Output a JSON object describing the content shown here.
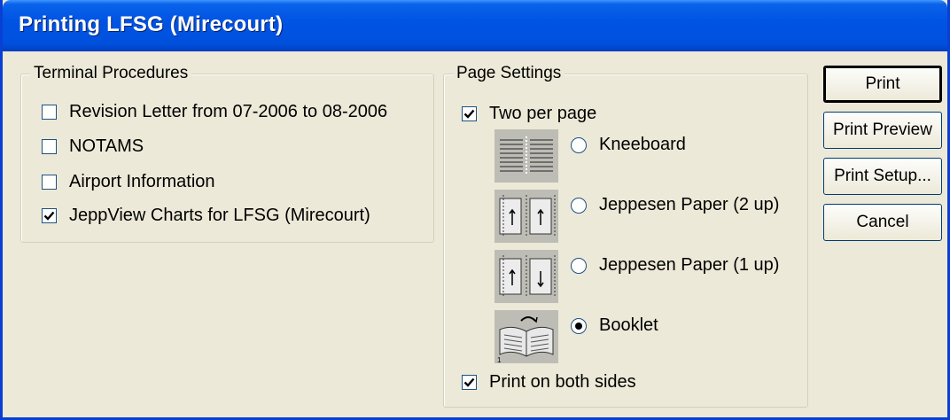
{
  "window": {
    "title": "Printing LFSG (Mirecourt)"
  },
  "terminal_procedures": {
    "legend": "Terminal Procedures",
    "items": [
      {
        "label": "Revision Letter from 07-2006 to 08-2006",
        "checked": false
      },
      {
        "label": "NOTAMS",
        "checked": false
      },
      {
        "label": "Airport Information",
        "checked": false
      },
      {
        "label": "JeppView Charts for LFSG (Mirecourt)",
        "checked": true
      }
    ]
  },
  "page_settings": {
    "legend": "Page Settings",
    "two_per_page": {
      "label": "Two per page",
      "checked": true
    },
    "layouts": [
      {
        "label": "Kneeboard",
        "selected": false,
        "icon": "kneeboard-layout-icon"
      },
      {
        "label": "Jeppesen Paper (2 up)",
        "selected": false,
        "icon": "jeppesen-2up-layout-icon"
      },
      {
        "label": "Jeppesen Paper (1 up)",
        "selected": false,
        "icon": "jeppesen-1up-layout-icon"
      },
      {
        "label": "Booklet",
        "selected": true,
        "icon": "booklet-layout-icon"
      }
    ],
    "both_sides": {
      "label": "Print on both sides",
      "checked": true
    }
  },
  "buttons": {
    "print": "Print",
    "print_preview": "Print Preview",
    "print_setup": "Print Setup...",
    "cancel": "Cancel"
  },
  "colors": {
    "titlebar": "#0054e3",
    "face": "#ece9d8",
    "frame": "#0a3fd4"
  }
}
